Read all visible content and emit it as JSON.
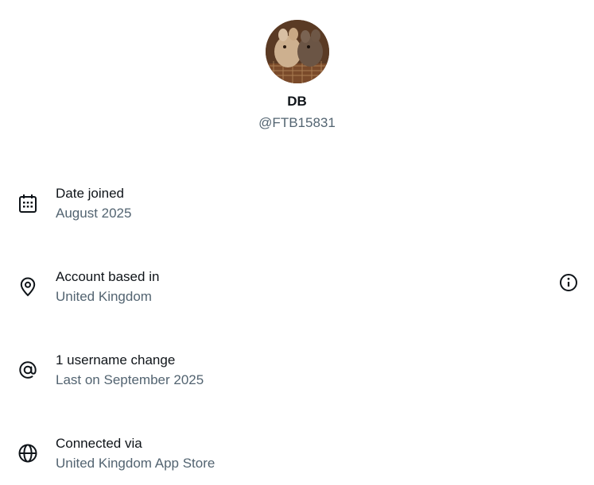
{
  "profile": {
    "avatar_icon": "avatar-photo-chinchillas",
    "display_name": "DB",
    "handle": "@FTB15831"
  },
  "rows": [
    {
      "icon": "calendar-icon",
      "title": "Date joined",
      "subtitle": "August 2025"
    },
    {
      "icon": "location-pin-icon",
      "title": "Account based in",
      "subtitle": "United Kingdom",
      "trailing_icon": "info-icon"
    },
    {
      "icon": "at-sign-icon",
      "title": "1 username change",
      "subtitle": "Last on September 2025"
    },
    {
      "icon": "globe-icon",
      "title": "Connected via",
      "subtitle": "United Kingdom App Store"
    }
  ],
  "colors": {
    "primary_text": "#0f1419",
    "secondary_text": "#536471",
    "background": "#ffffff"
  }
}
